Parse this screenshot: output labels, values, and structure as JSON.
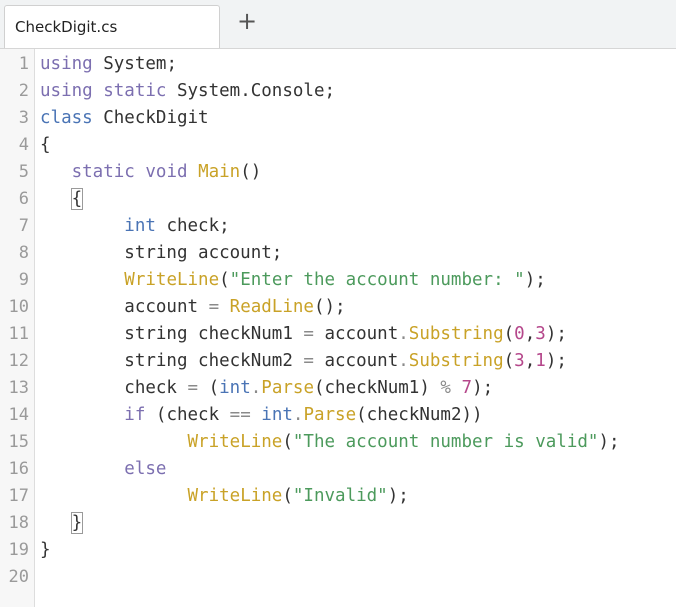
{
  "tab": {
    "label": "CheckDigit.cs",
    "add_symbol": "+"
  },
  "lines": [
    {
      "n": "1",
      "tokens": [
        {
          "t": "using",
          "c": "kw"
        },
        {
          "t": " System;",
          "c": "pl"
        }
      ]
    },
    {
      "n": "2",
      "tokens": [
        {
          "t": "using",
          "c": "kw"
        },
        {
          "t": " ",
          "c": "pl"
        },
        {
          "t": "static",
          "c": "kw"
        },
        {
          "t": " System.Console;",
          "c": "pl"
        }
      ]
    },
    {
      "n": "3",
      "tokens": [
        {
          "t": "class",
          "c": "ty"
        },
        {
          "t": " CheckDigit",
          "c": "pl"
        }
      ]
    },
    {
      "n": "4",
      "tokens": [
        {
          "t": "{",
          "c": "pl"
        }
      ]
    },
    {
      "n": "5",
      "tokens": [
        {
          "t": "   ",
          "c": "pl"
        },
        {
          "t": "static",
          "c": "kw"
        },
        {
          "t": " ",
          "c": "pl"
        },
        {
          "t": "void",
          "c": "kw"
        },
        {
          "t": " ",
          "c": "pl"
        },
        {
          "t": "Main",
          "c": "fn"
        },
        {
          "t": "()",
          "c": "pl"
        }
      ]
    },
    {
      "n": "6",
      "tokens": [
        {
          "t": "   ",
          "c": "pl"
        },
        {
          "t": "{",
          "c": "pl",
          "box": true
        }
      ]
    },
    {
      "n": "7",
      "tokens": [
        {
          "t": "        ",
          "c": "pl"
        },
        {
          "t": "int",
          "c": "ty"
        },
        {
          "t": " check;",
          "c": "pl"
        }
      ]
    },
    {
      "n": "8",
      "tokens": [
        {
          "t": "        string account;",
          "c": "pl"
        }
      ]
    },
    {
      "n": "9",
      "tokens": [
        {
          "t": "        ",
          "c": "pl"
        },
        {
          "t": "WriteLine",
          "c": "fn"
        },
        {
          "t": "(",
          "c": "pl"
        },
        {
          "t": "\"Enter the account number: \"",
          "c": "st"
        },
        {
          "t": ");",
          "c": "pl"
        }
      ]
    },
    {
      "n": "10",
      "tokens": [
        {
          "t": "        account ",
          "c": "pl"
        },
        {
          "t": "=",
          "c": "op"
        },
        {
          "t": " ",
          "c": "pl"
        },
        {
          "t": "ReadLine",
          "c": "fn"
        },
        {
          "t": "();",
          "c": "pl"
        }
      ]
    },
    {
      "n": "11",
      "tokens": [
        {
          "t": "        string checkNum1 ",
          "c": "pl"
        },
        {
          "t": "=",
          "c": "op"
        },
        {
          "t": " account",
          "c": "pl"
        },
        {
          "t": ".",
          "c": "op"
        },
        {
          "t": "Substring",
          "c": "fn"
        },
        {
          "t": "(",
          "c": "pl"
        },
        {
          "t": "0",
          "c": "nu"
        },
        {
          "t": ",",
          "c": "pl"
        },
        {
          "t": "3",
          "c": "nu"
        },
        {
          "t": ");",
          "c": "pl"
        }
      ]
    },
    {
      "n": "12",
      "tokens": [
        {
          "t": "        string checkNum2 ",
          "c": "pl"
        },
        {
          "t": "=",
          "c": "op"
        },
        {
          "t": " account",
          "c": "pl"
        },
        {
          "t": ".",
          "c": "op"
        },
        {
          "t": "Substring",
          "c": "fn"
        },
        {
          "t": "(",
          "c": "pl"
        },
        {
          "t": "3",
          "c": "nu"
        },
        {
          "t": ",",
          "c": "pl"
        },
        {
          "t": "1",
          "c": "nu"
        },
        {
          "t": ");",
          "c": "pl"
        }
      ]
    },
    {
      "n": "13",
      "tokens": [
        {
          "t": "        check ",
          "c": "pl"
        },
        {
          "t": "=",
          "c": "op"
        },
        {
          "t": " (",
          "c": "pl"
        },
        {
          "t": "int",
          "c": "ty"
        },
        {
          "t": ".",
          "c": "op"
        },
        {
          "t": "Parse",
          "c": "fn"
        },
        {
          "t": "(checkNum1) ",
          "c": "pl"
        },
        {
          "t": "%",
          "c": "op"
        },
        {
          "t": " ",
          "c": "pl"
        },
        {
          "t": "7",
          "c": "nu"
        },
        {
          "t": ");",
          "c": "pl"
        }
      ]
    },
    {
      "n": "14",
      "tokens": [
        {
          "t": "        ",
          "c": "pl"
        },
        {
          "t": "if",
          "c": "kw"
        },
        {
          "t": " (check ",
          "c": "pl"
        },
        {
          "t": "==",
          "c": "op"
        },
        {
          "t": " ",
          "c": "pl"
        },
        {
          "t": "int",
          "c": "ty"
        },
        {
          "t": ".",
          "c": "op"
        },
        {
          "t": "Parse",
          "c": "fn"
        },
        {
          "t": "(checkNum2))",
          "c": "pl"
        }
      ]
    },
    {
      "n": "15",
      "tokens": [
        {
          "t": "              ",
          "c": "pl"
        },
        {
          "t": "WriteLine",
          "c": "fn"
        },
        {
          "t": "(",
          "c": "pl"
        },
        {
          "t": "\"The account number is valid\"",
          "c": "st"
        },
        {
          "t": ");",
          "c": "pl"
        }
      ]
    },
    {
      "n": "16",
      "tokens": [
        {
          "t": "        ",
          "c": "pl"
        },
        {
          "t": "else",
          "c": "kw"
        }
      ]
    },
    {
      "n": "17",
      "tokens": [
        {
          "t": "              ",
          "c": "pl"
        },
        {
          "t": "WriteLine",
          "c": "fn"
        },
        {
          "t": "(",
          "c": "pl"
        },
        {
          "t": "\"Invalid\"",
          "c": "st"
        },
        {
          "t": ");",
          "c": "pl"
        }
      ]
    },
    {
      "n": "18",
      "tokens": [
        {
          "t": "   ",
          "c": "pl"
        },
        {
          "t": "}",
          "c": "pl",
          "box": true
        }
      ]
    },
    {
      "n": "19",
      "tokens": [
        {
          "t": "}",
          "c": "pl"
        }
      ]
    },
    {
      "n": "20",
      "tokens": []
    }
  ],
  "colors": {
    "keyword": "#7c6fb0",
    "type": "#4a74b5",
    "function": "#c9a227",
    "string": "#4c9a5c",
    "number": "#b5478b",
    "plain": "#333333",
    "operator": "#8a8a8a"
  }
}
